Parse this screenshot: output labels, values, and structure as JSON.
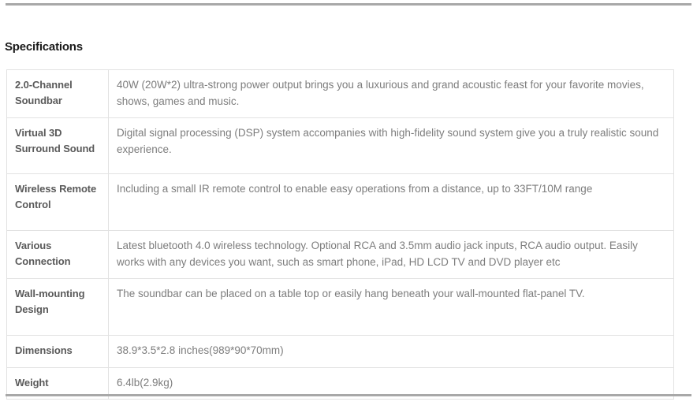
{
  "section": {
    "title": "Specifications"
  },
  "dividers": {
    "top_color": "#a8a8a8",
    "bottom_color": "#a8a8a8"
  },
  "colors": {
    "label_text": "#5a5a5a",
    "value_text": "#7d7d7d",
    "title_text": "#1a1a1a",
    "table_border": "#e2e2e2",
    "background": "#ffffff"
  },
  "spec_table": {
    "rows": [
      {
        "label": "2.0-Channel Soundbar",
        "value": "40W (20W*2) ultra-strong power output brings you a luxurious and grand acoustic feast for your favorite movies, shows, games and music."
      },
      {
        "label": "Virtual 3D Surround Sound",
        "value": "Digital signal processing (DSP) system accompanies with high-fidelity sound system give you a truly realistic sound experience."
      },
      {
        "label": "Wireless Remote Control",
        "value": "Including a small IR remote control to enable easy operations from a distance, up to 33FT/10M range"
      },
      {
        "label": "Various Connection",
        "value": "Latest bluetooth 4.0 wireless technology. Optional RCA and 3.5mm audio jack inputs, RCA audio output. Easily works with any devices you want, such as smart phone, iPad, HD LCD TV and DVD player etc"
      },
      {
        "label": "Wall-mounting Design",
        "value": "The soundbar can be placed on a table top or easily hang beneath your wall-mounted flat-panel TV."
      },
      {
        "label": "Dimensions",
        "value": "38.9*3.5*2.8 inches(989*90*70mm)"
      },
      {
        "label": "Weight",
        "value": "6.4lb(2.9kg)"
      }
    ]
  }
}
